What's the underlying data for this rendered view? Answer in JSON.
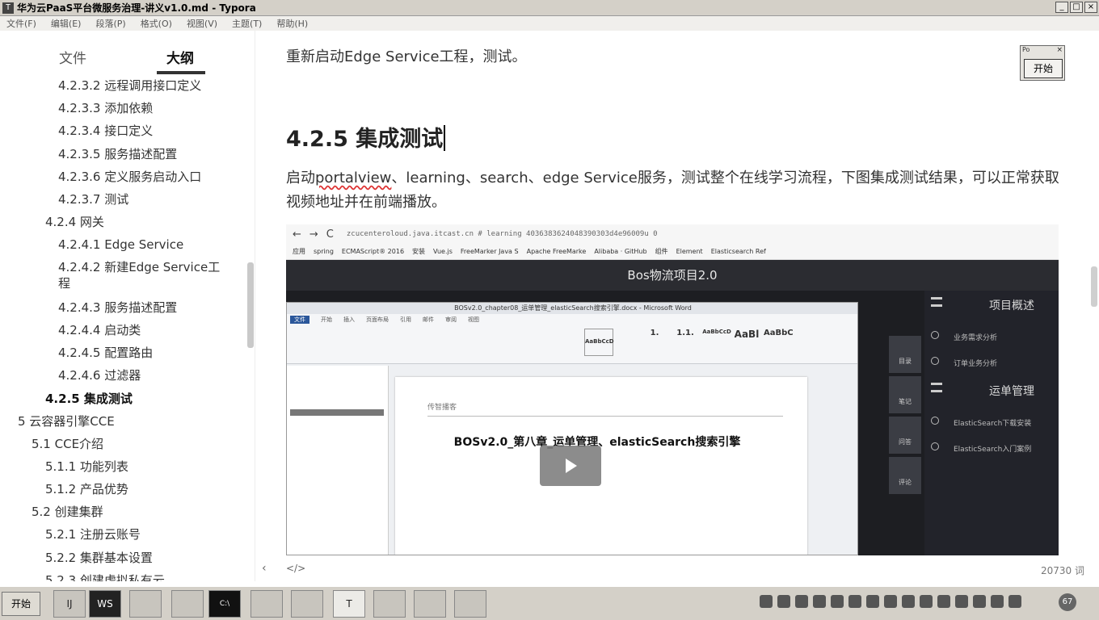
{
  "window": {
    "title": "华为云PaaS平台微服务治理-讲义v1.0.md - Typora",
    "app_icon": "T",
    "controls": [
      "_",
      "□",
      "×"
    ]
  },
  "menu": [
    "文件(F)",
    "编辑(E)",
    "段落(P)",
    "格式(O)",
    "视图(V)",
    "主题(T)",
    "帮助(H)"
  ],
  "sidebar": {
    "tabs": {
      "files": "文件",
      "outline": "大纲"
    },
    "items": [
      "4.2.3.2 远程调用接口定义",
      "4.2.3.3 添加依赖",
      "4.2.3.4 接口定义",
      "4.2.3.5 服务描述配置",
      "4.2.3.6 定义服务启动入口",
      "4.2.3.7 测试",
      "4.2.4 网关",
      "4.2.4.1 Edge Service",
      "4.2.4.2 新建Edge Service工程",
      "4.2.4.3 服务描述配置",
      "4.2.4.4 启动类",
      "4.2.4.5 配置路由",
      "4.2.4.6 过滤器",
      "4.2.5 集成测试",
      "5 云容器引擎CCE",
      "5.1 CCE介绍",
      "5.1.1 功能列表",
      "5.1.2 产品优势",
      "5.2 创建集群",
      "5.2.1 注册云账号",
      "5.2.2 集群基本设置",
      "5.2.3 创建虚拟私有云"
    ]
  },
  "editor": {
    "p1": "重新启动Edge Service工程，测试。",
    "heading": "4.2.5 集成测试",
    "p2_before": "启动",
    "p2_spell": "portalview",
    "p2_after": "、learning、search、edge Service服务，测试整个在线学习流程，下图集成测试结果，可以正常获取视频地址并在前端播放。"
  },
  "screenshot": {
    "url": "zcucenteroloud.java.itcast.cn # learning 4036383624048390303d4e96009u 0",
    "bookmarks": [
      "应用",
      "spring",
      "ECMAScript® 2016",
      "安装",
      "Vue.js",
      "FreeMarker Java S",
      "Apache FreeMarke",
      "Alibaba · GitHub",
      "组件",
      "Element",
      "Elasticsearch Ref"
    ],
    "app_title": "Bos物流项目2.0",
    "menu": {
      "overview": "项目概述",
      "req": "业务需求分析",
      "order": "订单业务分析",
      "waybill": "运单管理",
      "es1": "ElasticSearch下载安装",
      "es2": "ElasticSearch入门案例"
    },
    "icons": [
      "目录",
      "笔记",
      "问答",
      "评论"
    ],
    "word_title": "BOSv2.0_chapter08_运单管理_elasticSearch搜索引擎.docx - Microsoft Word",
    "ribbon_tabs": [
      "文件",
      "开始",
      "插入",
      "页面布局",
      "引用",
      "邮件",
      "审阅",
      "视图"
    ],
    "styles": [
      "AaBbCcD",
      "1.",
      "1.1.",
      "AaBbCcD",
      "AaBl",
      "AaBbC"
    ],
    "page_logo": "传智播客",
    "page_title": "BOSv2.0_第八章_运单管理、elasticSearch搜索引擎"
  },
  "widget": {
    "title": "Po",
    "close": "×",
    "button": "开始"
  },
  "status": {
    "back": "‹",
    "source": "</>",
    "words": "20730 词"
  },
  "taskbar": {
    "start": "开始",
    "items": [
      "IJ",
      "WS",
      "",
      "",
      "C:\\",
      "",
      "",
      "T",
      "",
      "",
      ""
    ],
    "clock": "67"
  }
}
